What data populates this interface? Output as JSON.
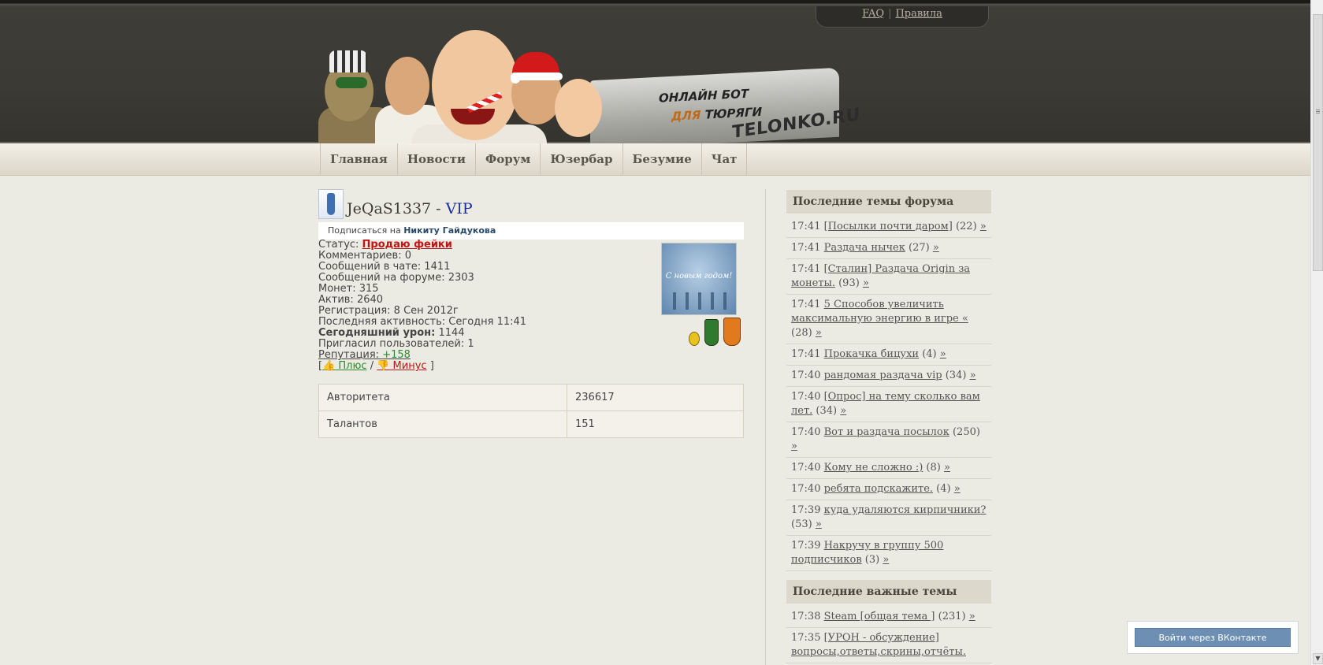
{
  "toplinks": {
    "faq": "FAQ",
    "sep": "|",
    "rules": "Правила"
  },
  "banner": {
    "line1": "ОНЛАЙН БОТ",
    "line2_pre": "",
    "line2_dl": "ДЛЯ",
    "line2_post": " ТЮРЯГИ",
    "logo": "TELONKO.RU"
  },
  "nav": [
    "Главная",
    "Новости",
    "Форум",
    "Юзербар",
    "Безумие",
    "Чат"
  ],
  "profile": {
    "name": "JeQaS1337",
    "dash": " - ",
    "vip": "VIP",
    "subscribe_prefix": "Подписаться на ",
    "subscribe_target": "Никиту Гайдукова",
    "status_label": "Статус: ",
    "status_value": "Продаю фейки",
    "stats": [
      "Комментариев: 0",
      "Сообщений в чате: 1411",
      "Сообщений на форуме: 2303",
      "Монет: 315",
      "Актив: 2640",
      "Регистрация: 8 Сен 2012г",
      "Последняя активность: Сегодня 11:41"
    ],
    "damage_label": "Сегодняшний урон:",
    "damage_value": " 1144",
    "invited": "Пригласил пользователей: 1",
    "rep_label": "Репутация: ",
    "rep_value": "+158",
    "plus": " Плюс",
    "minus": " Минус",
    "card_text": "С новым годом!",
    "table": [
      {
        "k": "Авторитета",
        "v": "236617"
      },
      {
        "k": "Талантов",
        "v": "151"
      }
    ]
  },
  "sidebar": {
    "forum_title": "Последние темы форума",
    "forum": [
      {
        "t": "17:41",
        "title": "[Посылки почти даром]",
        "count": "(22)"
      },
      {
        "t": "17:41",
        "title": "Раздача нычек",
        "count": "(27)"
      },
      {
        "t": "17:41",
        "title": "[Сталин] Раздача Origin за монеты.",
        "count": "(93)"
      },
      {
        "t": "17:41",
        "title": "5 Способов увеличить максимальную энергию в игре «",
        "count": "(28)"
      },
      {
        "t": "17:41",
        "title": "Прокачка бицухи",
        "count": "(4)"
      },
      {
        "t": "17:40",
        "title": "рандомая раздача vip",
        "count": "(34)"
      },
      {
        "t": "17:40",
        "title": "[Опрос] на тему сколько вам лет.",
        "count": "(34)"
      },
      {
        "t": "17:40",
        "title": "Вот и раздача посылок",
        "count": "(250)"
      },
      {
        "t": "17:40",
        "title": "Кому не сложно :)",
        "count": "(8)"
      },
      {
        "t": "17:40",
        "title": "ребята подскажите.",
        "count": "(4)"
      },
      {
        "t": "17:39",
        "title": "куда удаляются кирпичники?",
        "count": "(53)"
      },
      {
        "t": "17:39",
        "title": "Накручу в группу 500 подписчиков",
        "count": "(3)"
      }
    ],
    "arrow": "»",
    "important_title": "Последние важные темы",
    "important": [
      {
        "t": "17:38",
        "title": "Steam [общая тема ]",
        "count": "(231)"
      },
      {
        "t": "17:35",
        "title": "[УРОН - обсуждение] вопросы,ответы,скрины,отчёты.",
        "count": ""
      }
    ]
  },
  "vk_button": "Войти через ВКонтакте"
}
